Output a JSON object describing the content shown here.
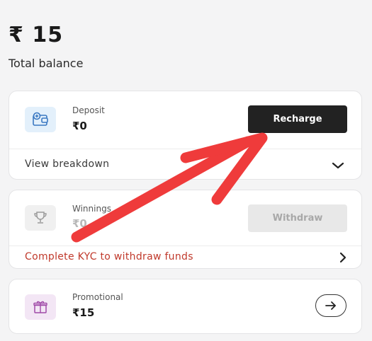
{
  "balance": {
    "amount": "₹ 15",
    "label": "Total balance"
  },
  "deposit": {
    "title": "Deposit",
    "value": "₹0",
    "recharge_label": "Recharge",
    "breakdown_label": "View breakdown",
    "icon": "wallet-plus-icon"
  },
  "winnings": {
    "title": "Winnings",
    "value": "₹0",
    "withdraw_label": "Withdraw",
    "kyc_label": "Complete KYC to withdraw funds",
    "icon": "trophy-icon"
  },
  "promotional": {
    "title": "Promotional",
    "value": "₹15",
    "icon": "gift-icon"
  },
  "colors": {
    "annotation_arrow": "#ef3b3b",
    "kyc_text": "#c0392b",
    "deposit_icon_bg": "#e3f0fb",
    "promo_icon_bg": "#f3e6f5"
  }
}
